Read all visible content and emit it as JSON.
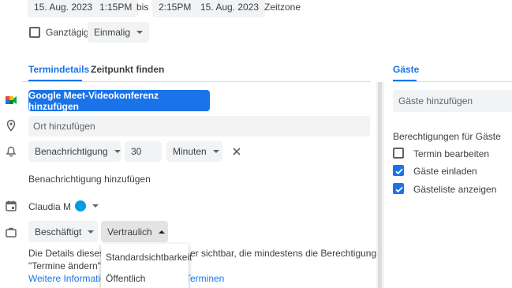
{
  "datetime": {
    "start_date": "15. Aug. 2023",
    "start_time": "1:15PM",
    "separator": "bis",
    "end_time": "2:15PM",
    "end_date": "15. Aug. 2023",
    "timezone_label": "Zeitzone"
  },
  "allday": {
    "label": "Ganztägig",
    "checked": false
  },
  "recurrence": {
    "value": "Einmalig"
  },
  "tabs": [
    {
      "label": "Termindetails",
      "active": true
    },
    {
      "label": "Zeitpunkt finden",
      "active": false
    }
  ],
  "meet": {
    "button_label": "Google Meet-Videokonferenz hinzufügen"
  },
  "location": {
    "placeholder": "Ort hinzufügen"
  },
  "notification": {
    "type": "Benachrichtigung",
    "amount": "30",
    "unit": "Minuten",
    "add_label": "Benachrichtigung hinzufügen"
  },
  "calendar": {
    "owner": "Claudia M",
    "color": "#039be5"
  },
  "status": {
    "availability": "Beschäftigt",
    "visibility": "Vertraulich"
  },
  "visibility_menu": {
    "items": [
      "Standardsichtbarkeit",
      "Öffentlich"
    ]
  },
  "info": {
    "line1_a": "Die Details dieses Te",
    "line1_b": "er sichtbar, die mindestens die Berechtigung",
    "line2_a": "\"Termine ändern\" fü",
    "line3_link_a": "Weitere Information",
    "line3_link_b": "Terminen"
  },
  "guests": {
    "tab_label": "Gäste",
    "input_placeholder": "Gäste hinzufügen",
    "permissions_title": "Berechtigungen für Gäste",
    "permissions": [
      {
        "label": "Termin bearbeiten",
        "checked": false
      },
      {
        "label": "Gäste einladen",
        "checked": true
      },
      {
        "label": "Gästeliste anzeigen",
        "checked": true
      }
    ]
  },
  "colors": {
    "accent": "#1a73e8",
    "chip_bg": "#f1f3f4",
    "text": "#3c4043",
    "divider": "#dadce0"
  }
}
